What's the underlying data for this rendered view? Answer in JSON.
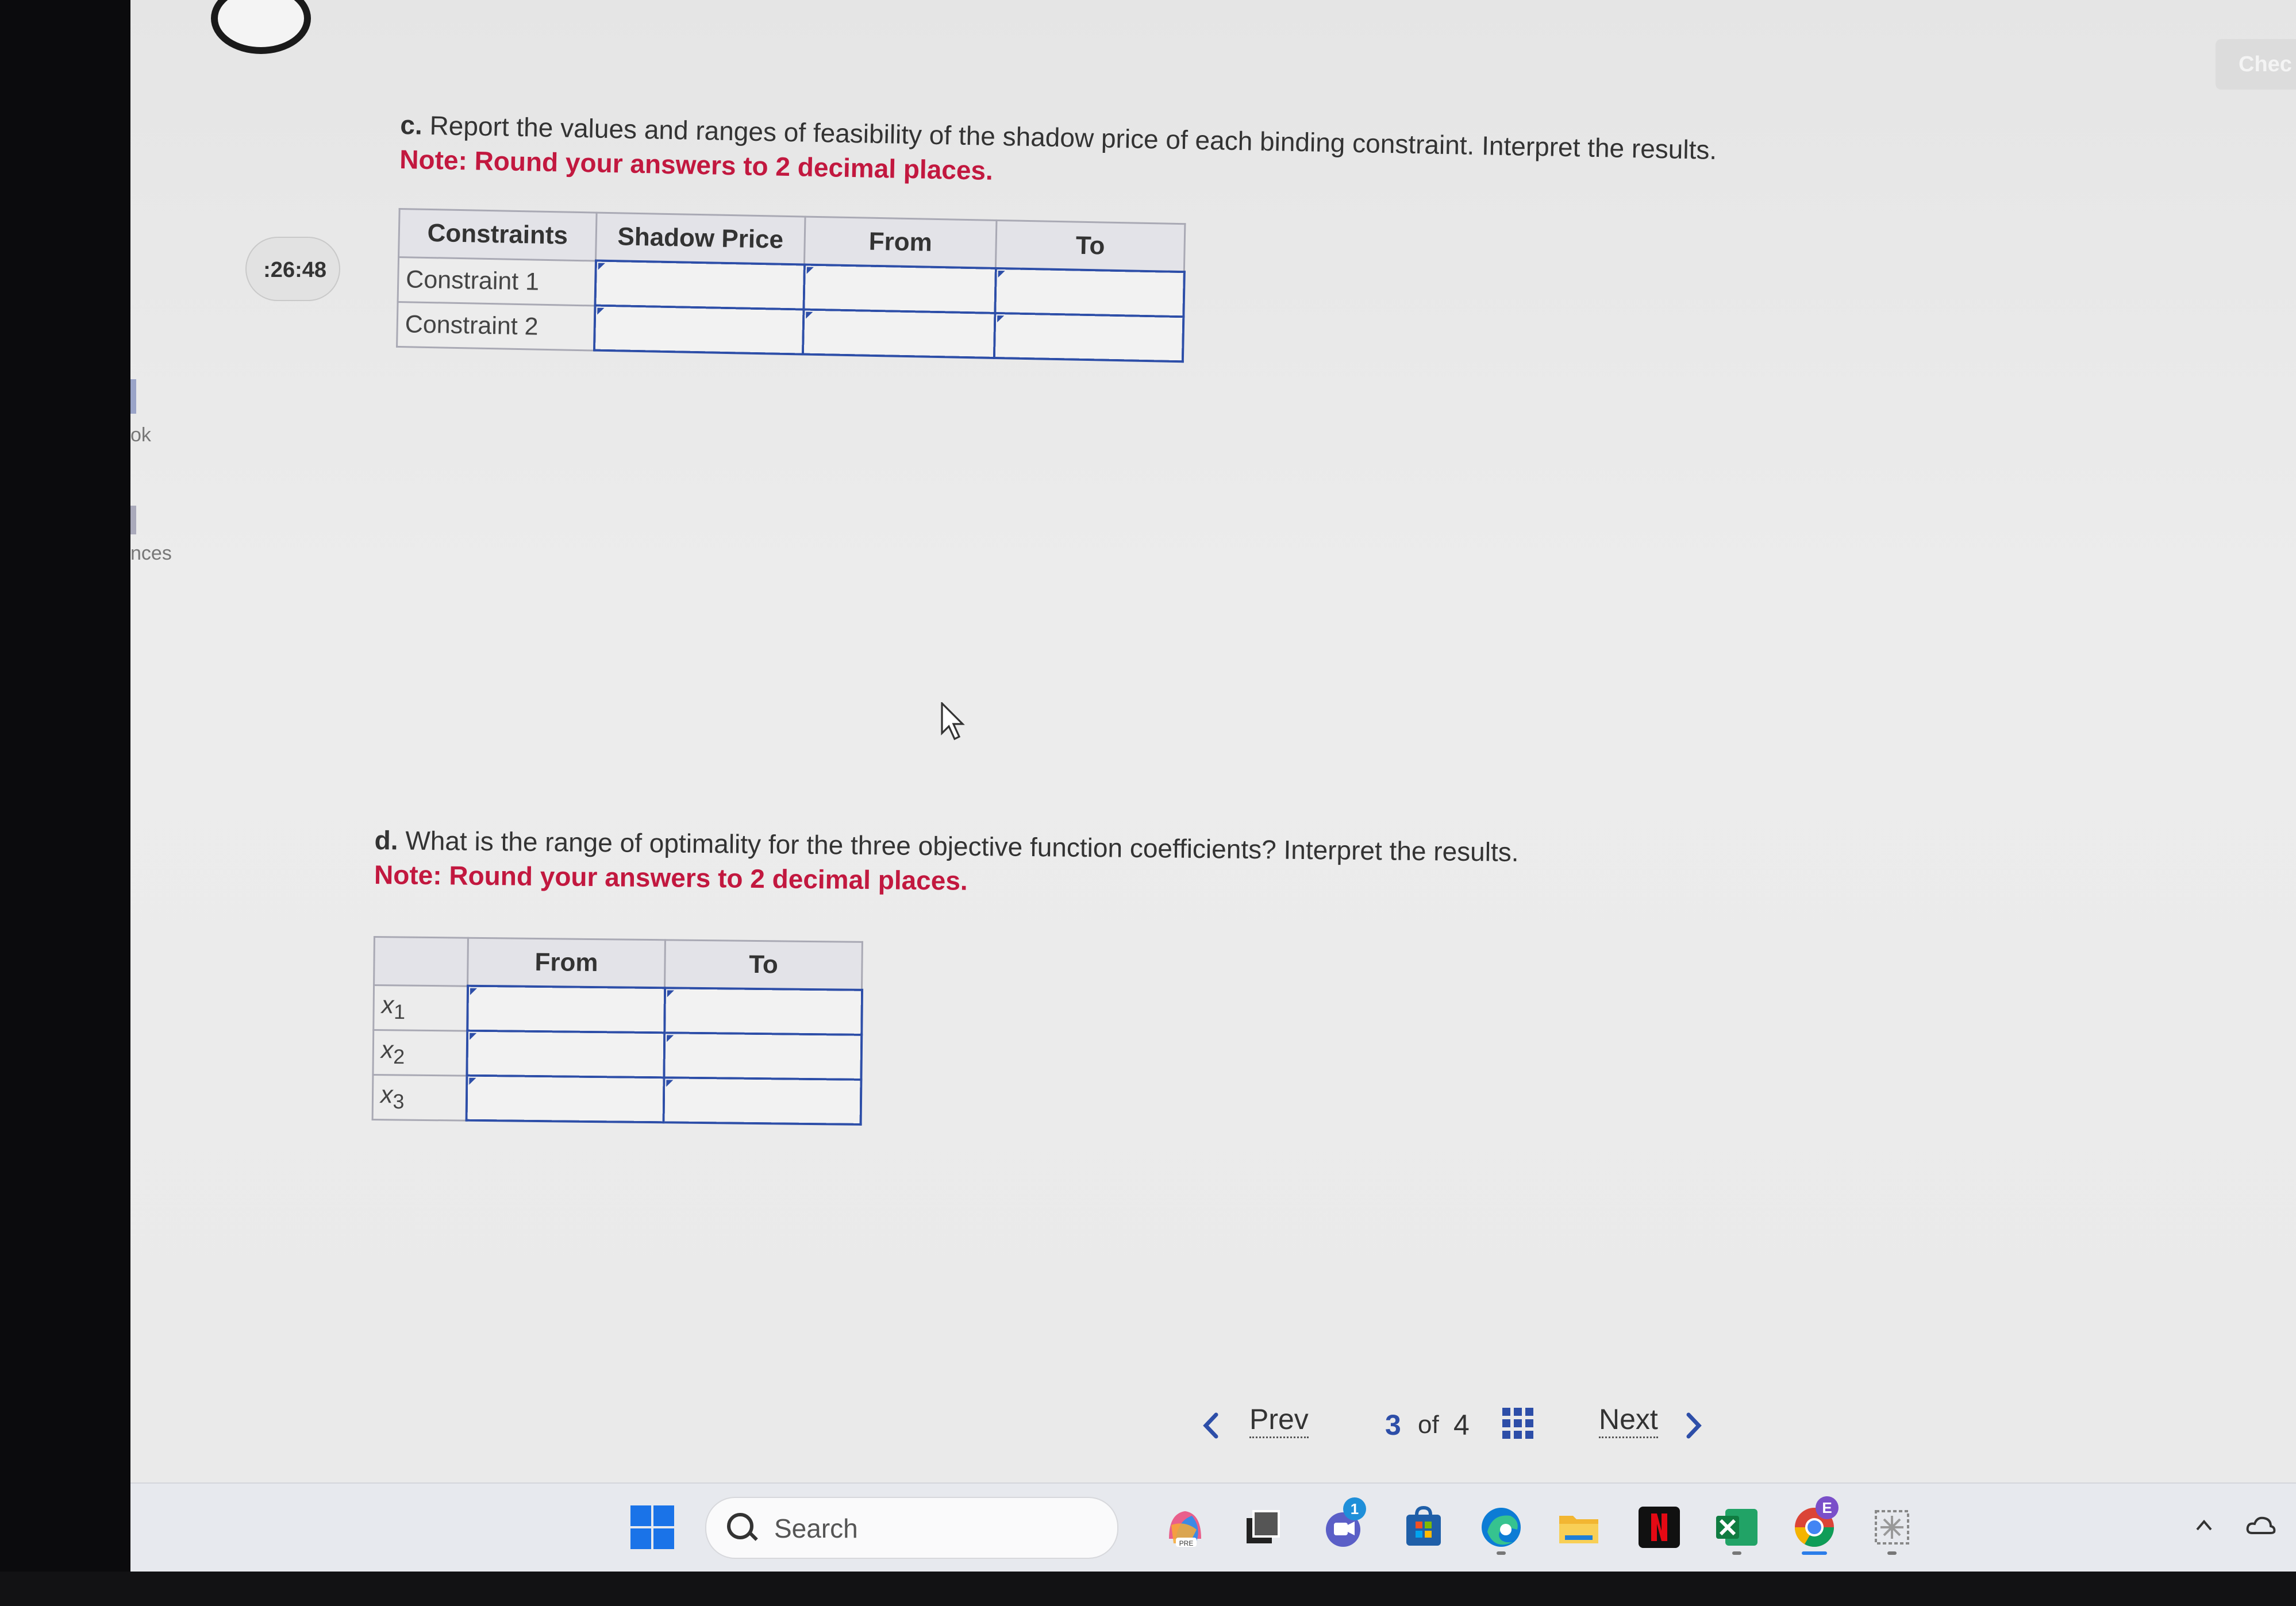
{
  "sidebar": {
    "timer": ":26:48",
    "items": [
      {
        "label": "ok"
      },
      {
        "label": "nces"
      }
    ]
  },
  "header": {
    "check_label": "Chec"
  },
  "section_c": {
    "letter": "c.",
    "question": "Report the values and ranges of feasibility of the shadow price of each binding constraint. Interpret the results.",
    "note": "Note: Round your answers to 2 decimal places.",
    "table": {
      "headers": [
        "Constraints",
        "Shadow Price",
        "From",
        "To"
      ],
      "rows": [
        {
          "label": "Constraint 1",
          "shadow_price": "",
          "from": "",
          "to": ""
        },
        {
          "label": "Constraint 2",
          "shadow_price": "",
          "from": "",
          "to": ""
        }
      ]
    }
  },
  "section_d": {
    "letter": "d.",
    "question": "What is the range of optimality for the three objective function coefficients? Interpret the results.",
    "note": "Note: Round your answers to 2 decimal places.",
    "table": {
      "headers": [
        "",
        "From",
        "To"
      ],
      "rows": [
        {
          "var": "x",
          "sub": "1",
          "from": "",
          "to": ""
        },
        {
          "var": "x",
          "sub": "2",
          "from": "",
          "to": ""
        },
        {
          "var": "x",
          "sub": "3",
          "from": "",
          "to": ""
        }
      ]
    }
  },
  "pager": {
    "prev": "Prev",
    "current": "3",
    "of": "of",
    "total": "4",
    "next": "Next"
  },
  "taskbar": {
    "search_placeholder": "Search",
    "badges": {
      "chat": "1",
      "chrome": "E"
    },
    "icons": [
      "windows-start-icon",
      "copilot-icon",
      "task-view-icon",
      "chat-icon",
      "store-icon",
      "edge-icon",
      "file-explorer-icon",
      "netflix-icon",
      "excel-icon",
      "chrome-icon",
      "snipping-icon"
    ],
    "store_colors": [
      "#f25022",
      "#7fba00",
      "#00a4ef",
      "#ffb900"
    ]
  }
}
